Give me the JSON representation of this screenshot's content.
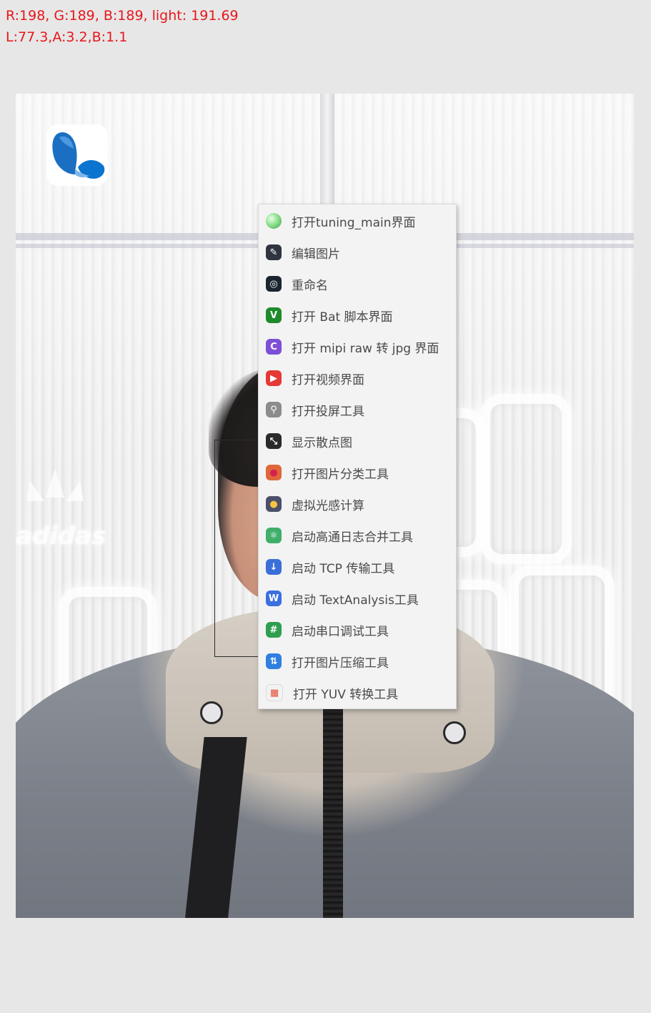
{
  "readout": {
    "line1": "R:198, G:189, B:189, light: 191.69",
    "line2": "L:77.3,A:3.2,B:1.1"
  },
  "photo": {
    "sign_text": "adidas"
  },
  "menu": {
    "items": [
      {
        "label": "打开tuning_main界面",
        "icon": "green-orb-icon",
        "color": "#5cc46a",
        "glyph": ""
      },
      {
        "label": "编辑图片",
        "icon": "edit-image-icon",
        "color": "#2f3440",
        "glyph": "✎"
      },
      {
        "label": "重命名",
        "icon": "rename-icon",
        "color": "#1b2530",
        "glyph": "◎"
      },
      {
        "label": "打开 Bat 脚本界面",
        "icon": "bat-script-icon",
        "color": "#1f8a2a",
        "glyph": "V"
      },
      {
        "label": "打开 mipi raw 转 jpg 界面",
        "icon": "mipi-convert-icon",
        "color": "#7d4fd6",
        "glyph": "C"
      },
      {
        "label": "打开视频界面",
        "icon": "video-icon",
        "color": "#e53935",
        "glyph": "▶"
      },
      {
        "label": "打开投屏工具",
        "icon": "usb-cast-icon",
        "color": "#8c8c8c",
        "glyph": "⚲"
      },
      {
        "label": "显示散点图",
        "icon": "scatter-plot-icon",
        "color": "#2a2a2a",
        "glyph": "⤡"
      },
      {
        "label": "打开图片分类工具",
        "icon": "image-classify-icon",
        "color": "#e0663b",
        "glyph": "●"
      },
      {
        "label": "虚拟光感计算",
        "icon": "light-bulb-icon",
        "color": "#4b4f6a",
        "glyph": "●"
      },
      {
        "label": "启动高通日志合并工具",
        "icon": "log-merge-icon",
        "color": "#3fae6a",
        "glyph": "⚛"
      },
      {
        "label": "启动 TCP 传输工具",
        "icon": "tcp-transfer-icon",
        "color": "#3a6fd8",
        "glyph": "↓"
      },
      {
        "label": "启动 TextAnalysis工具",
        "icon": "text-analysis-icon",
        "color": "#3b6fe0",
        "glyph": "W"
      },
      {
        "label": "启动串口调试工具",
        "icon": "serial-debug-icon",
        "color": "#2e9e4f",
        "glyph": "#"
      },
      {
        "label": "打开图片压缩工具",
        "icon": "image-compress-icon",
        "color": "#2f7fe0",
        "glyph": "⇅"
      },
      {
        "label": "打开 YUV 转换工具",
        "icon": "yuv-convert-icon",
        "color": "#f2f2f2",
        "glyph": "▦"
      }
    ]
  }
}
